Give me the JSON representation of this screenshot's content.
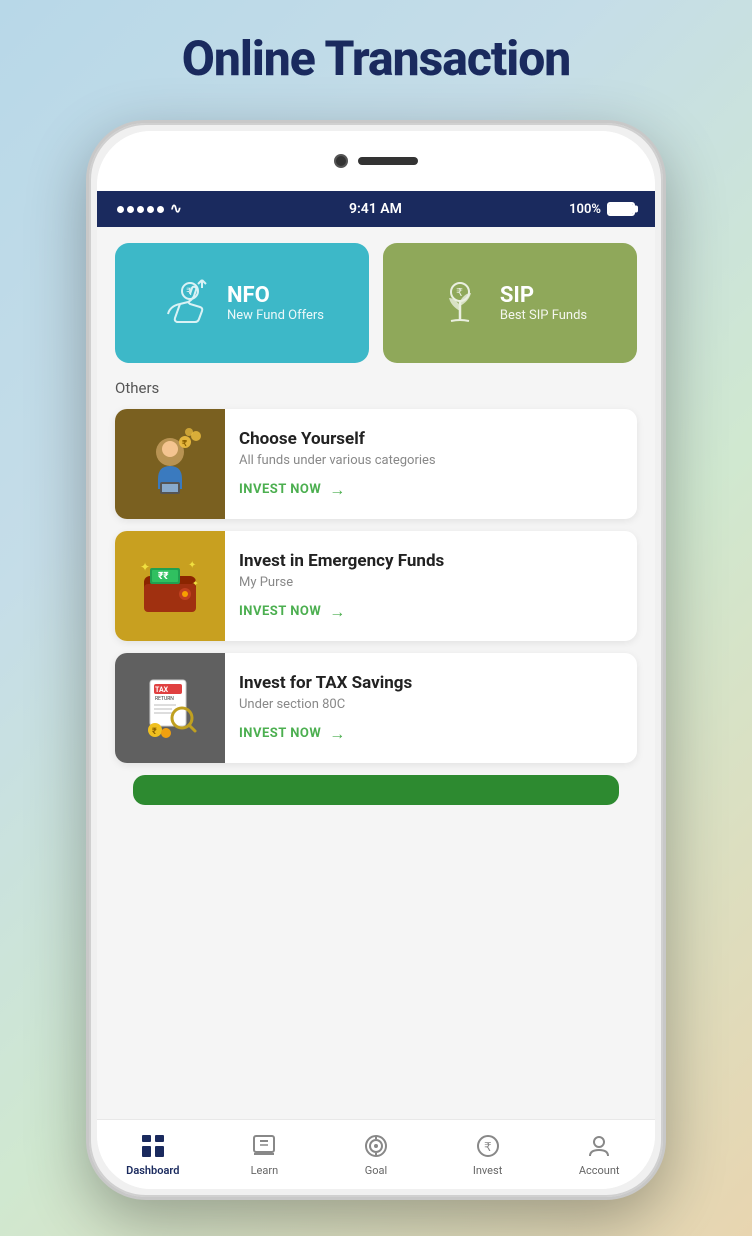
{
  "page": {
    "title": "Online Transaction",
    "background": "linear-gradient"
  },
  "status_bar": {
    "time": "9:41 AM",
    "battery": "100%",
    "signal": "•••••",
    "wifi": "wifi"
  },
  "fund_cards": [
    {
      "id": "nfo",
      "title": "NFO",
      "subtitle": "New Fund Offers",
      "color": "#3db8c8"
    },
    {
      "id": "sip",
      "title": "SIP",
      "subtitle": "Best SIP Funds",
      "color": "#8fa85a"
    }
  ],
  "others_label": "Others",
  "list_items": [
    {
      "title": "Choose Yourself",
      "subtitle": "All funds under various categories",
      "cta": "INVEST NOW",
      "bg_color": "#7a6020"
    },
    {
      "title": "Invest in Emergency Funds",
      "subtitle": "My Purse",
      "cta": "INVEST NOW",
      "bg_color": "#c8a020"
    },
    {
      "title": "Invest for TAX Savings",
      "subtitle": "Under section 80C",
      "cta": "INVEST NOW",
      "bg_color": "#606060"
    }
  ],
  "bottom_nav": {
    "items": [
      {
        "id": "dashboard",
        "label": "Dashboard",
        "active": true
      },
      {
        "id": "learn",
        "label": "Learn",
        "active": false
      },
      {
        "id": "goal",
        "label": "Goal",
        "active": false
      },
      {
        "id": "invest",
        "label": "Invest",
        "active": false
      },
      {
        "id": "account",
        "label": "Account",
        "active": false
      }
    ]
  }
}
